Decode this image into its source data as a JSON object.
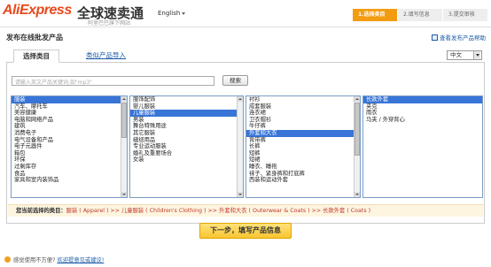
{
  "header": {
    "logo_brand": "AliExpress",
    "logo_brand_cn": "全球速卖通",
    "logo_sub": "阿里巴巴旗下网站",
    "language": "English"
  },
  "steps": [
    "1.选择类目",
    "2.填写信息",
    "3.提交审核"
  ],
  "page_title": "发布在线批发产品",
  "help_link": "查看发布产品帮助",
  "tabs": {
    "active": "选择类目",
    "link": "类似产品导入"
  },
  "lang_select": "中文",
  "search": {
    "placeholder": "请输入英文产品关键词,如\"mp3\"",
    "button": "搜索"
  },
  "lists": {
    "l1": {
      "items": [
        "服装",
        "汽车、摩托车",
        "美容健康",
        "电脑和网络产品",
        "建筑",
        "消费电子",
        "电气设备和产品",
        "电子元器件",
        "箱包",
        "环保",
        "过剩库存",
        "食品",
        "家具和室内装饰品"
      ],
      "selected": 0
    },
    "l2": {
      "items": [
        "服饰配饰",
        "婴儿服装",
        "儿童服装",
        "男装",
        "舞台特殊用途",
        "其它服装",
        "缝纫用品",
        "专业运动服装",
        "婚礼及重要场合",
        "女装"
      ],
      "selected": 2
    },
    "l3": {
      "items": [
        "衬衫",
        "成套服装",
        "连衣裙",
        "卫衣帽衫",
        "牛仔裤",
        "外套和大衣",
        "背带裤",
        "长裤",
        "短裤",
        "短裙",
        "睡衣、睡袍",
        "袜子、紧身裤和打底裤",
        "西装和运动外套"
      ],
      "selected": 5
    },
    "l4": {
      "items": [
        "长款外套",
        "夹克",
        "雨衣",
        "马夹 / 外穿背心"
      ],
      "selected": 0
    }
  },
  "selected_path": {
    "label": "您当前选择的类目：",
    "value": "服装 ( Apparel ) >> 儿童服装 ( Children's Clothing ) >> 外套和大衣 ( Outerwear & Coats ) >> 长款外套 ( Coats )"
  },
  "next_button": "下一步，填写产品信息",
  "footer": {
    "text": "感觉使用不方便?",
    "link": "欢迎提意见或建议!"
  }
}
